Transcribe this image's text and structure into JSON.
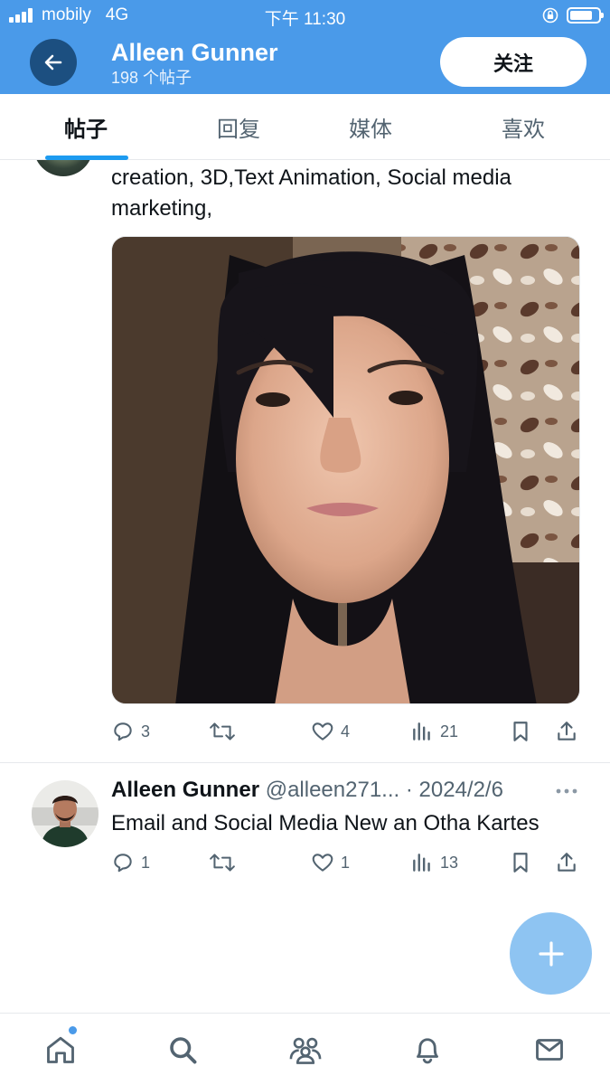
{
  "status_bar": {
    "carrier": "mobily",
    "network": "4G",
    "time": "下午 11:30"
  },
  "header": {
    "name": "Alleen Gunner",
    "post_count": "198 个帖子",
    "follow_label": "关注"
  },
  "tabs": [
    {
      "label": "帖子",
      "active": true
    },
    {
      "label": "回复",
      "active": false
    },
    {
      "label": "媒体",
      "active": false
    },
    {
      "label": "喜欢",
      "active": false
    }
  ],
  "tweet1": {
    "text_line1": "creation, 3D,Text Animation, Social media",
    "text_line2": "marketing,",
    "stats": {
      "replies": "3",
      "likes": "4",
      "views": "21"
    }
  },
  "tweet2": {
    "name": "Alleen Gunner",
    "handle": "@alleen271...",
    "separator": "·",
    "date": "2024/2/6",
    "text": "Email and Social Media New an Otha Kartes",
    "stats": {
      "replies": "1",
      "likes": "1",
      "views": "13"
    }
  },
  "colors": {
    "accent": "#4a9ae9",
    "header_bg": "#4a9ae9",
    "back_button": "#1c4f80",
    "fab": "#8ec4f2",
    "text_secondary": "#536471"
  },
  "icons": [
    "arrow-left-icon",
    "reply-icon",
    "retweet-icon",
    "like-icon",
    "views-icon",
    "bookmark-icon",
    "share-icon",
    "more-icon",
    "compose-plus-icon",
    "home-icon",
    "search-icon",
    "communities-icon",
    "notifications-icon",
    "messages-icon"
  ]
}
